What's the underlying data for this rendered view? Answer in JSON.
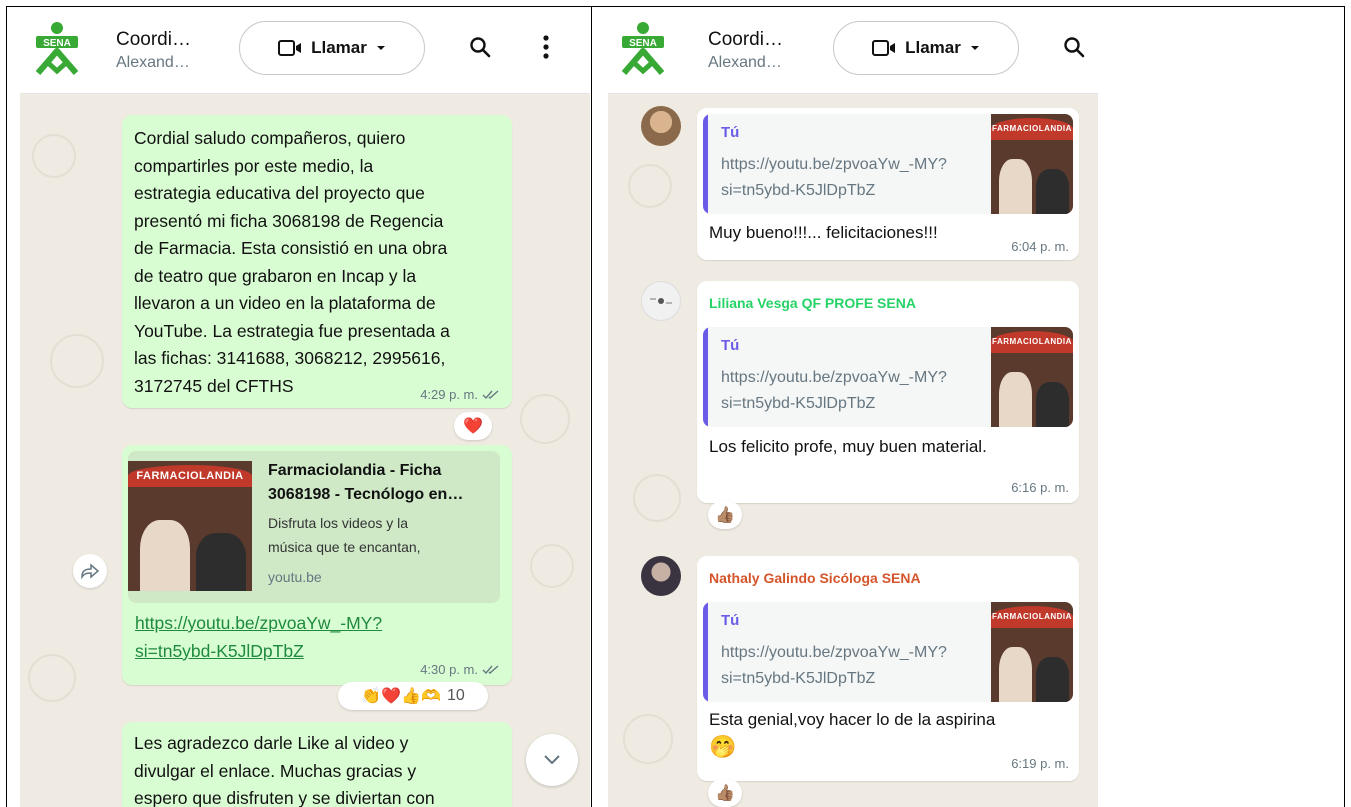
{
  "colors": {
    "chat_bg": "#efeae2",
    "outgoing_bubble": "#d9fdd3",
    "incoming_bubble": "#ffffff",
    "link": "#1e8a3e",
    "quote_accent": "#6b5ce7",
    "sena_green": "#39a935"
  },
  "left": {
    "header": {
      "title": "Coordi…",
      "subtitle": "Alexand…",
      "call_label": "Llamar",
      "icons": [
        "video-icon",
        "chevron-down-icon",
        "search-icon",
        "more-vert-icon"
      ]
    },
    "messages": [
      {
        "text": "Cordial saludo compañeros, quiero\ncompartirles por este medio, la\nestrategia educativa del proyecto que\npresentó mi ficha 3068198 de Regencia\nde Farmacia.  Esta consistió en una obra\nde teatro que grabaron en Incap y la\nllevaron a un video en la plataforma de\nYouTube. La estrategia fue presentada a\nlas fichas: 3141688, 3068212, 2995616,\n3172745 del CFTHS",
        "time": "4:29 p. m.",
        "reactions": "❤️"
      },
      {
        "preview_title": "Farmaciolandia - Ficha\n3068198 - Tecnólogo en…",
        "preview_desc": "Disfruta los videos y la\nmúsica que te encantan,",
        "preview_domain": "youtu.be",
        "thumb_label": "FARMACIOLANDIA",
        "link": "https://youtu.be/zpvoaYw_-MY?\nsi=tn5ybd-K5JlDpTbZ",
        "time": "4:30 p. m.",
        "reactions": "👏❤️👍🫶",
        "reaction_count": "10"
      },
      {
        "text": "Les agradezco darle Like al video y\ndivulgar el enlace. Muchas gracias y\nespero que disfruten y se diviertan con"
      }
    ]
  },
  "right": {
    "header": {
      "title": "Coordi…",
      "subtitle": "Alexand…",
      "call_label": "Llamar"
    },
    "messages": [
      {
        "quote_author": "Tú",
        "quote_text": "https://youtu.be/zpvoaYw_-MY?\nsi=tn5ybd-K5JlDpTbZ",
        "thumb_label": "FARMACIOLANDIA",
        "text": "Muy bueno!!!... felicitaciones!!!",
        "time": "6:04 p. m."
      },
      {
        "sender": "Liliana Vesga QF PROFE SENA",
        "sender_color": "#25d366",
        "quote_author": "Tú",
        "quote_text": "https://youtu.be/zpvoaYw_-MY?\nsi=tn5ybd-K5JlDpTbZ",
        "thumb_label": "FARMACIOLANDIA",
        "text": "Los felicito profe, muy buen material.",
        "time": "6:16 p. m.",
        "reactions": "👍🏽"
      },
      {
        "sender": "Nathaly Galindo Sicóloga SENA",
        "sender_color": "#d4552b",
        "quote_author": "Tú",
        "quote_text": "https://youtu.be/zpvoaYw_-MY?\nsi=tn5ybd-K5JlDpTbZ",
        "thumb_label": "FARMACIOLANDIA",
        "text": "Esta genial,voy hacer lo de la aspirina",
        "emoji": "🤭",
        "time": "6:19 p. m.",
        "reactions": "👍🏽"
      }
    ]
  }
}
